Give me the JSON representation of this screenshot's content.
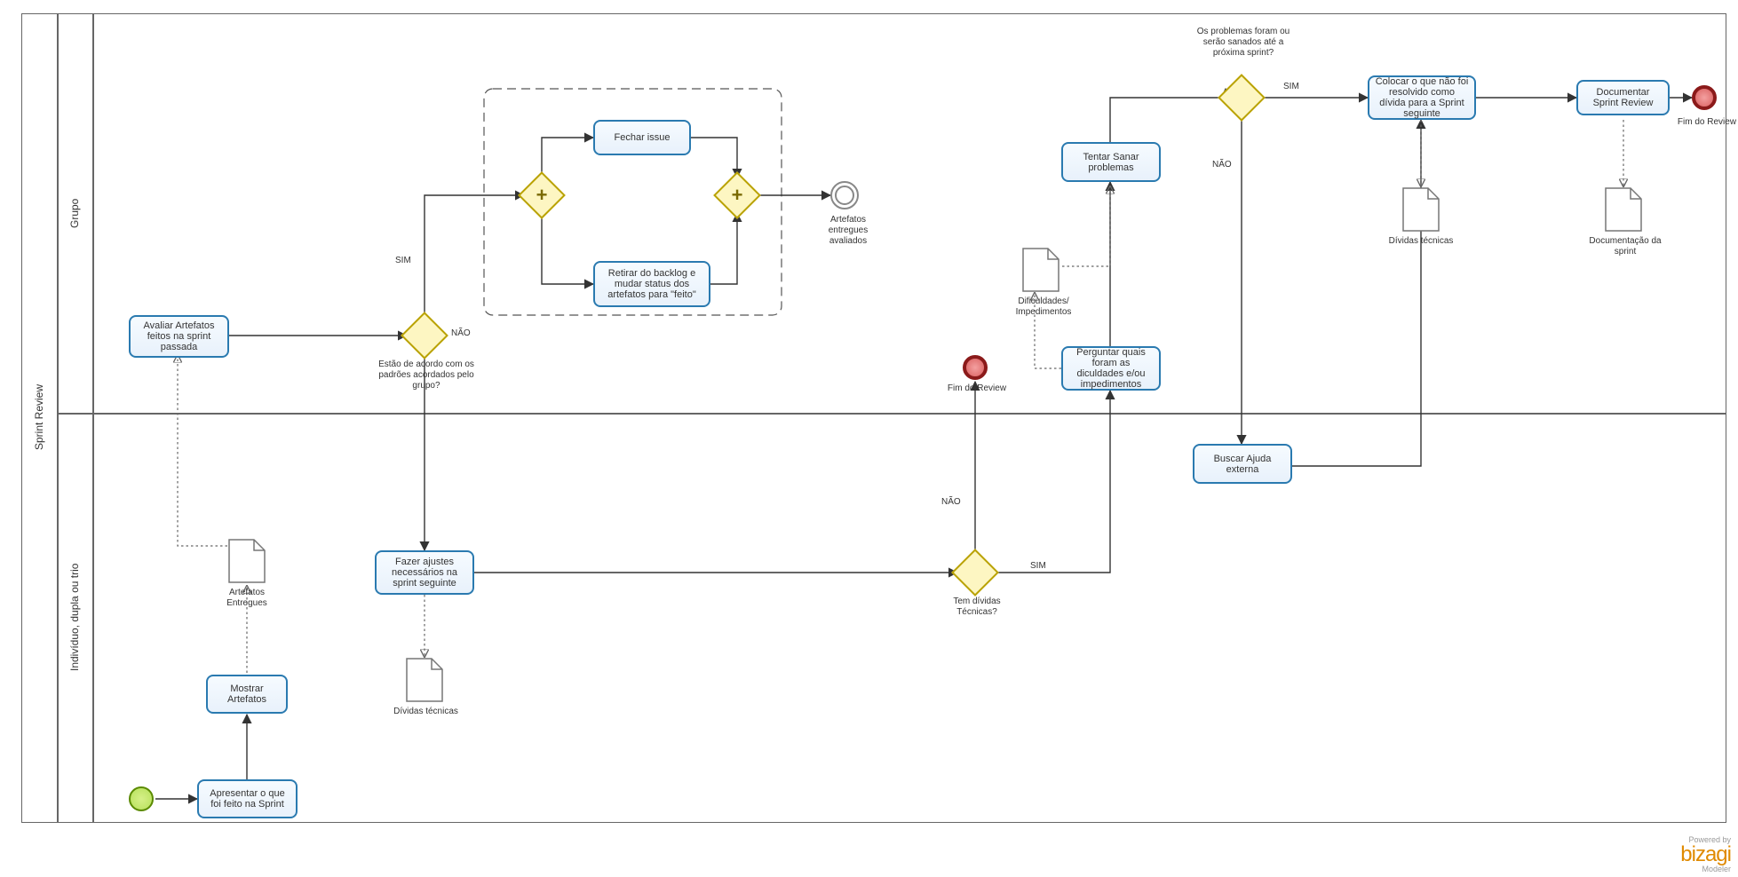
{
  "pool": {
    "title": "Sprint Review"
  },
  "lanes": {
    "grupo": "Grupo",
    "individuo": "Indivíduo, dupla ou trio"
  },
  "tasks": {
    "avaliar": "Avaliar Artefatos feitos na sprint passada",
    "apresentar": "Apresentar o que foi feito na Sprint",
    "mostrar": "Mostrar Artefatos",
    "fechar": "Fechar issue",
    "retirar": "Retirar do backlog e mudar status dos artefatos para \"feito\"",
    "ajustes": "Fazer ajustes necessários na sprint seguinte",
    "perguntar": "Perguntar quais foram as diculdades e/ou impedimentos",
    "sanar": "Tentar Sanar problemas",
    "buscar": "Buscar Ajuda externa",
    "colocar": "Colocar o que não foi resolvido como dívida para a Sprint seguinte",
    "documentar": "Documentar Sprint Review"
  },
  "gateways": {
    "padroes": "Estão de acordo com os padrões acordados pelo grupo?",
    "dividas": "Tem dívidas Técnicas?",
    "problemas": "Os problemas foram ou serão sanados até a próxima sprint?"
  },
  "events": {
    "artavaliados": "Artefatos entregues avaliados",
    "fim1": "Fim do Review",
    "fim2": "Fim do Review"
  },
  "edgeLabels": {
    "sim": "SIM",
    "nao": "NÃO"
  },
  "artifacts": {
    "artEntregues": "Artefatos Entregues",
    "divTecnicas1": "Dívidas técnicas",
    "divTecnicas2": "Dívidas técnicas",
    "dificuldades": "Dificuldades/ Impedimentos",
    "docSprint": "Documentação da sprint"
  },
  "branding": {
    "powered": "Powered by",
    "name": "bizagi",
    "sub": "Modeler"
  }
}
